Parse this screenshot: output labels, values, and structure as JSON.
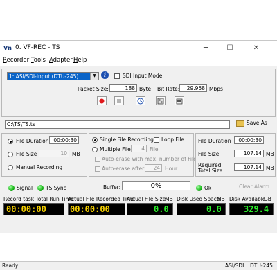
{
  "window": {
    "title": "0. VF-REC - TS",
    "app_icon": "Vn",
    "minimize": "─",
    "maximize": "☐",
    "close": "✕"
  },
  "menu": [
    {
      "label": "Recorder",
      "key": "R",
      "rest": "ecorder"
    },
    {
      "label": "Tools",
      "key": "T",
      "rest": "ools"
    },
    {
      "label": "Adapter",
      "key": "A",
      "rest": "dapter"
    },
    {
      "label": "Help",
      "key": "H",
      "rest": "elp"
    }
  ],
  "input": {
    "selected": "1: ASI/SDI-Input (DTU-245)",
    "sdi_mode_label": "SDI Input Mode",
    "packet_size_label": "Packet Size:",
    "packet_size": "188",
    "packet_size_unit": "Byte",
    "bit_rate_label": "Bit Rate:",
    "bit_rate": "29.958",
    "bit_rate_unit": "Mbps"
  },
  "file": {
    "path": "C:\\TS\\TS.ts",
    "save_as_label": "Save As"
  },
  "mode": {
    "file_duration_label": "File Duration",
    "file_duration": "00:00:30",
    "file_size_label": "File Size",
    "file_size": "10",
    "file_size_unit": "MB",
    "manual_label": "Manual Recording"
  },
  "recording": {
    "single_label": "Single File Recording",
    "loop_label": "Loop File",
    "multiple_label": "Multiple Files",
    "multiple_count": "4",
    "multiple_unit": "File",
    "auto_erase_max_label": "Auto-erase with max. number of Files",
    "auto_erase_after_label": "Auto-erase after",
    "auto_erase_after": "24",
    "auto_erase_after_unit": "Hour"
  },
  "stats": {
    "file_duration_label": "File Duration",
    "file_duration": "00:00:30",
    "file_size_label": "File Size",
    "file_size": "107.14",
    "file_size_unit": "MB",
    "required_label_1": "Required",
    "required_label_2": "Total Size",
    "required_total": "107.14",
    "required_unit": "MB"
  },
  "indicators": {
    "signal_label": "Signal",
    "ts_sync_label": "TS Sync",
    "buffer_label": "Buffer:",
    "buffer_value": "0%",
    "ok_label": "Ok",
    "clear_alarm_label": "Clear Alarm"
  },
  "displays": {
    "task_label": "Record task Total Run Time",
    "task_value": "00:00:00",
    "actual_label": "Actual File Recorded Time",
    "actual_value": "00:00:00",
    "actual_size_label": "Actual File Size",
    "actual_size_unit": "MB",
    "actual_size_value": "0.0",
    "disk_used_label": "Disk Used Space",
    "disk_used_unit": "MB",
    "disk_used_value": "0.0",
    "disk_avail_label": "Disk Available",
    "disk_avail_unit": "GB",
    "disk_avail_value": "329.4"
  },
  "statusbar": {
    "left": "Ready",
    "mode": "ASI/SDI",
    "device": "DTU-245"
  },
  "colors": {
    "selection": "#0a64c8",
    "lcd_yellow": "#f6d000",
    "lcd_green": "#2bf02b",
    "led_green": "#17b517"
  }
}
